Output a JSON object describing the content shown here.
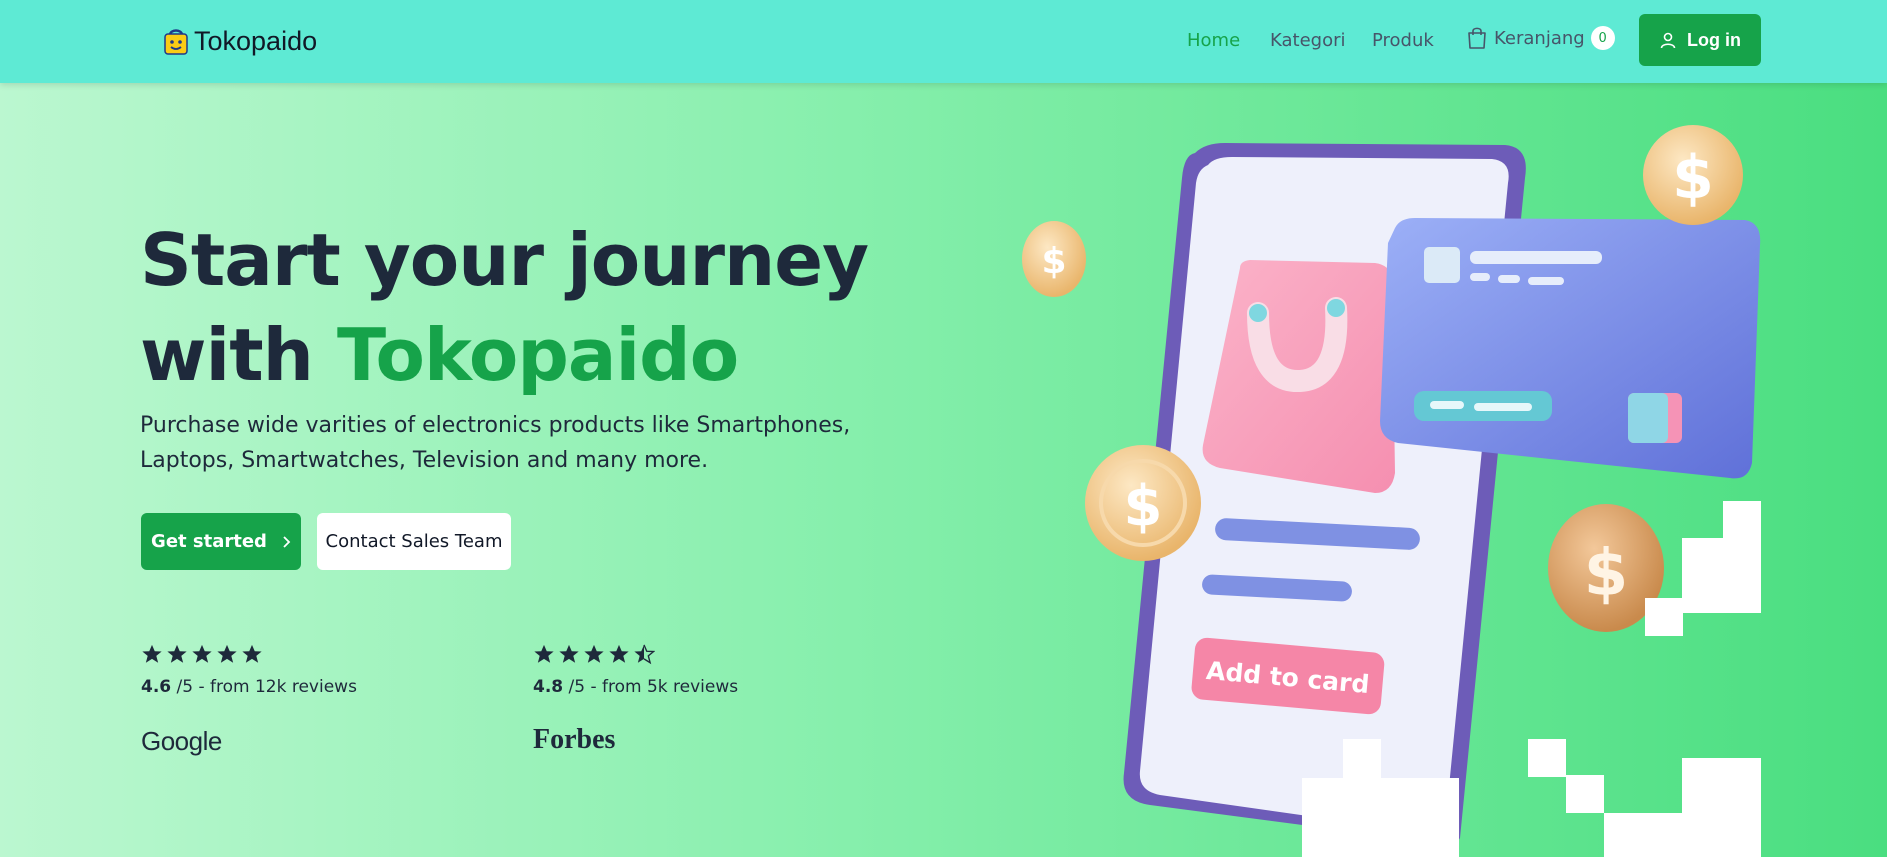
{
  "brand": {
    "name": "Tokopaido"
  },
  "nav": {
    "links": [
      {
        "label": "Home",
        "active": true
      },
      {
        "label": "Kategori",
        "active": false
      },
      {
        "label": "Produk",
        "active": false
      }
    ],
    "cart": {
      "label": "Keranjang",
      "count": "0"
    },
    "login_label": "Log in"
  },
  "hero": {
    "title_line1": "Start your journey",
    "title_line2_prefix": "with ",
    "title_line2_accent": "Tokopaido",
    "subtitle": "Purchase wide varities of electronics products like Smartphones, Laptops, Smartwatches, Television and many more.",
    "primary_button": "Get started",
    "secondary_button": "Contact Sales Team",
    "ratings": [
      {
        "score": "4.6",
        "suffix": "/5 - from 12k reviews",
        "stars": 5,
        "source": "Google"
      },
      {
        "score": "4.8",
        "suffix": "/5 - from 5k reviews",
        "stars": 4.5,
        "source": "Forbes"
      }
    ],
    "illustration": {
      "button_text": "Add to card"
    }
  },
  "colors": {
    "navbar": "#5eead4",
    "accent": "#16a34a",
    "text_dark": "#1e293b",
    "text_muted": "#475569",
    "phone_frame": "#6d5cb8",
    "card_blue": "#7c8fe8",
    "bag_pink": "#f9a8c0",
    "coin": "#f2c98c"
  }
}
